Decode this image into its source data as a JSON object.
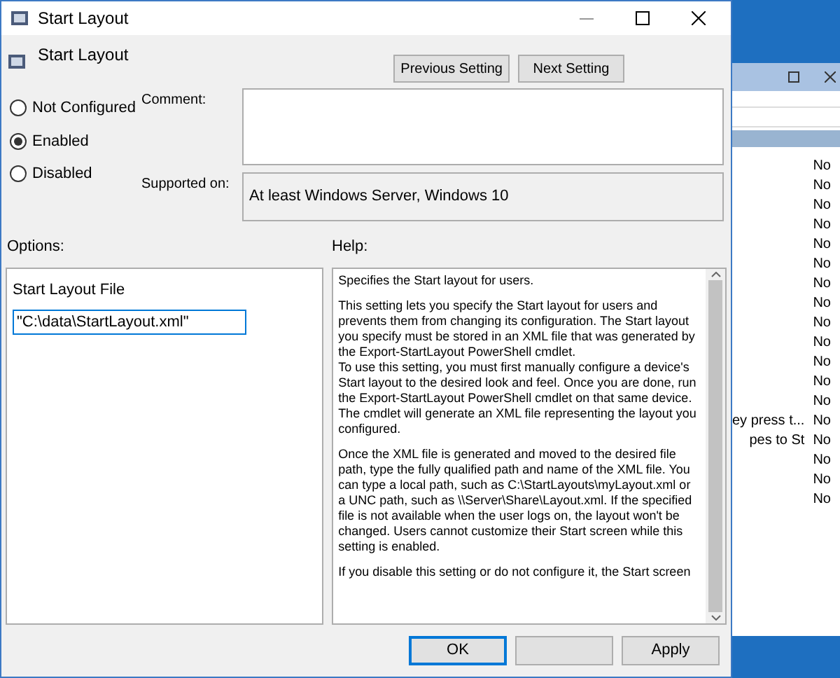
{
  "window": {
    "title": "Start Layout"
  },
  "header": {
    "title": "Start Layout",
    "buttons": [
      "Previous Setting",
      "Next Setting"
    ]
  },
  "state_options": [
    {
      "label": "Not Configured",
      "selected": false
    },
    {
      "label": "Enabled",
      "selected": true
    },
    {
      "label": "Disabled",
      "selected": false
    }
  ],
  "comment": {
    "label": "Comment:"
  },
  "supported_on": {
    "label": "Supported on:",
    "value": "At least Windows Server, Windows 10"
  },
  "options": {
    "label": "Options:",
    "field_label": "Start Layout File",
    "field_value": "\"C:\\data\\StartLayout.xml\""
  },
  "help": {
    "label": "Help:",
    "blocks": [
      [
        "Specifies the Start layout for users."
      ],
      [
        "This setting lets you specify the Start layout for users and prevents them from changing its configuration. The Start layout you specify must be stored in an XML file that was generated by the Export-StartLayout PowerShell cmdlet.",
        "To use this setting, you must first manually configure a device's Start layout to the desired look and feel. Once you are done, run the Export-StartLayout PowerShell cmdlet on that same device. The cmdlet will generate an XML file representing the layout you configured."
      ],
      [
        "Once the XML file is generated and moved to the desired file path, type the fully qualified path and name of the XML file. You can type a local path, such as C:\\StartLayouts\\myLayout.xml or a UNC path, such as \\\\Server\\Share\\Layout.xml. If the specified file is not available when the user logs on, the layout won't be changed. Users cannot customize their Start screen while this setting is enabled."
      ],
      [
        "If you disable this setting or do not configure it, the Start screen"
      ]
    ]
  },
  "footer_buttons": [
    {
      "label": "OK",
      "default": true
    },
    {
      "default": false
    },
    {
      "label": "Apply",
      "default": false
    }
  ],
  "background_window": {
    "rows": [
      {
        "state": "No"
      },
      {
        "state": "No"
      },
      {
        "state": "No"
      },
      {
        "state": "No"
      },
      {
        "state": "No"
      },
      {
        "state": "No"
      },
      {
        "state": "No"
      },
      {
        "state": "No"
      },
      {
        "state": "No"
      },
      {
        "state": "No"
      },
      {
        "state": "No"
      },
      {
        "state": "No"
      },
      {
        "state": "No"
      },
      {
        "name": "ey press t...",
        "state": "No"
      },
      {
        "name": "pes to St",
        "state": "No"
      },
      {
        "state": "No"
      },
      {
        "state": "No"
      },
      {
        "state": "No"
      }
    ]
  }
}
